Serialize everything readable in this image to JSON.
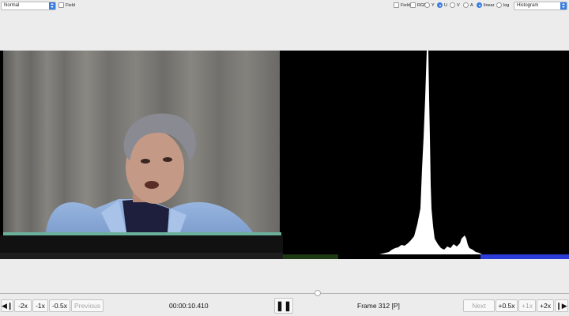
{
  "toolbar": {
    "mode_select": "Normal",
    "field_left_label": "Field",
    "field_right_label": "Field",
    "rgb_label": "RGB",
    "channels": [
      {
        "label": "Y",
        "selected": false
      },
      {
        "label": "U",
        "selected": true
      },
      {
        "label": "V",
        "selected": false
      },
      {
        "label": "A",
        "selected": false
      }
    ],
    "scales": [
      {
        "label": "linear",
        "selected": true
      },
      {
        "label": "log",
        "selected": false
      }
    ],
    "view_select": "Histogram"
  },
  "transport": {
    "prev_frame_icon": "step-back-icon",
    "minus2x": "-2x",
    "minus1x": "-1x",
    "minus05x": "-0.5x",
    "previous": "Previous",
    "timecode": "00:00:10.410",
    "play_pause_icon": "pause-icon",
    "frame_label": "Frame 312 [P]",
    "next": "Next",
    "plus05x": "+0.5x",
    "plus1x": "+1x",
    "plus2x": "+2x",
    "next_frame_icon": "step-forward-icon",
    "playhead_position": 0.557
  },
  "colors": {
    "accent": "#3a7de0",
    "background": "#ececec",
    "panel": "#000000"
  }
}
